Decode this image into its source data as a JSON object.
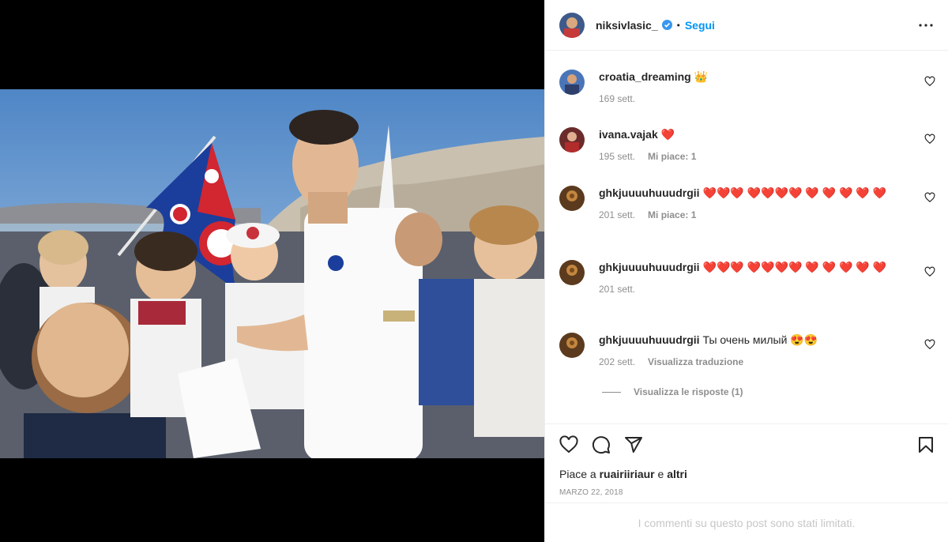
{
  "post": {
    "author": "niksivlasic_",
    "separator": "•",
    "follow_label": "Segui",
    "image_alt": "Player in white shirt signing autographs for children with Hajduk Split flags"
  },
  "comments": [
    {
      "user": "croatia_dreaming",
      "text": "👑",
      "time": "169 sett.",
      "likes": "",
      "extra": ""
    },
    {
      "user": "ivana.vajak",
      "text": "❤️",
      "time": "195 sett.",
      "likes": "Mi piace: 1",
      "extra": ""
    },
    {
      "user": "ghkjuuuuhuuudrgii",
      "text": "❤️❤️❤️ ❤️❤️❤️❤️ ❤️ ❤️ ❤️ ❤️ ❤️",
      "time": "201 sett.",
      "likes": "Mi piace: 1",
      "extra": ""
    },
    {
      "user": "ghkjuuuuhuuudrgii",
      "text": "❤️❤️❤️ ❤️❤️❤️❤️ ❤️ ❤️ ❤️ ❤️ ❤️",
      "time": "201 sett.",
      "likes": "",
      "extra": ""
    },
    {
      "user": "ghkjuuuuhuuudrgii",
      "text": "Ты очень милый 😍😍",
      "time": "202 sett.",
      "likes": "",
      "extra": "Visualizza traduzione"
    }
  ],
  "view_replies": "Visualizza le risposte (1)",
  "likes_line": {
    "prefix": "Piace a",
    "user": "ruairiiriaur",
    "joiner": "e",
    "others": "altri"
  },
  "date": "MARZO 22, 2018",
  "limited_notice": "I commenti su questo post sono stati limitati."
}
